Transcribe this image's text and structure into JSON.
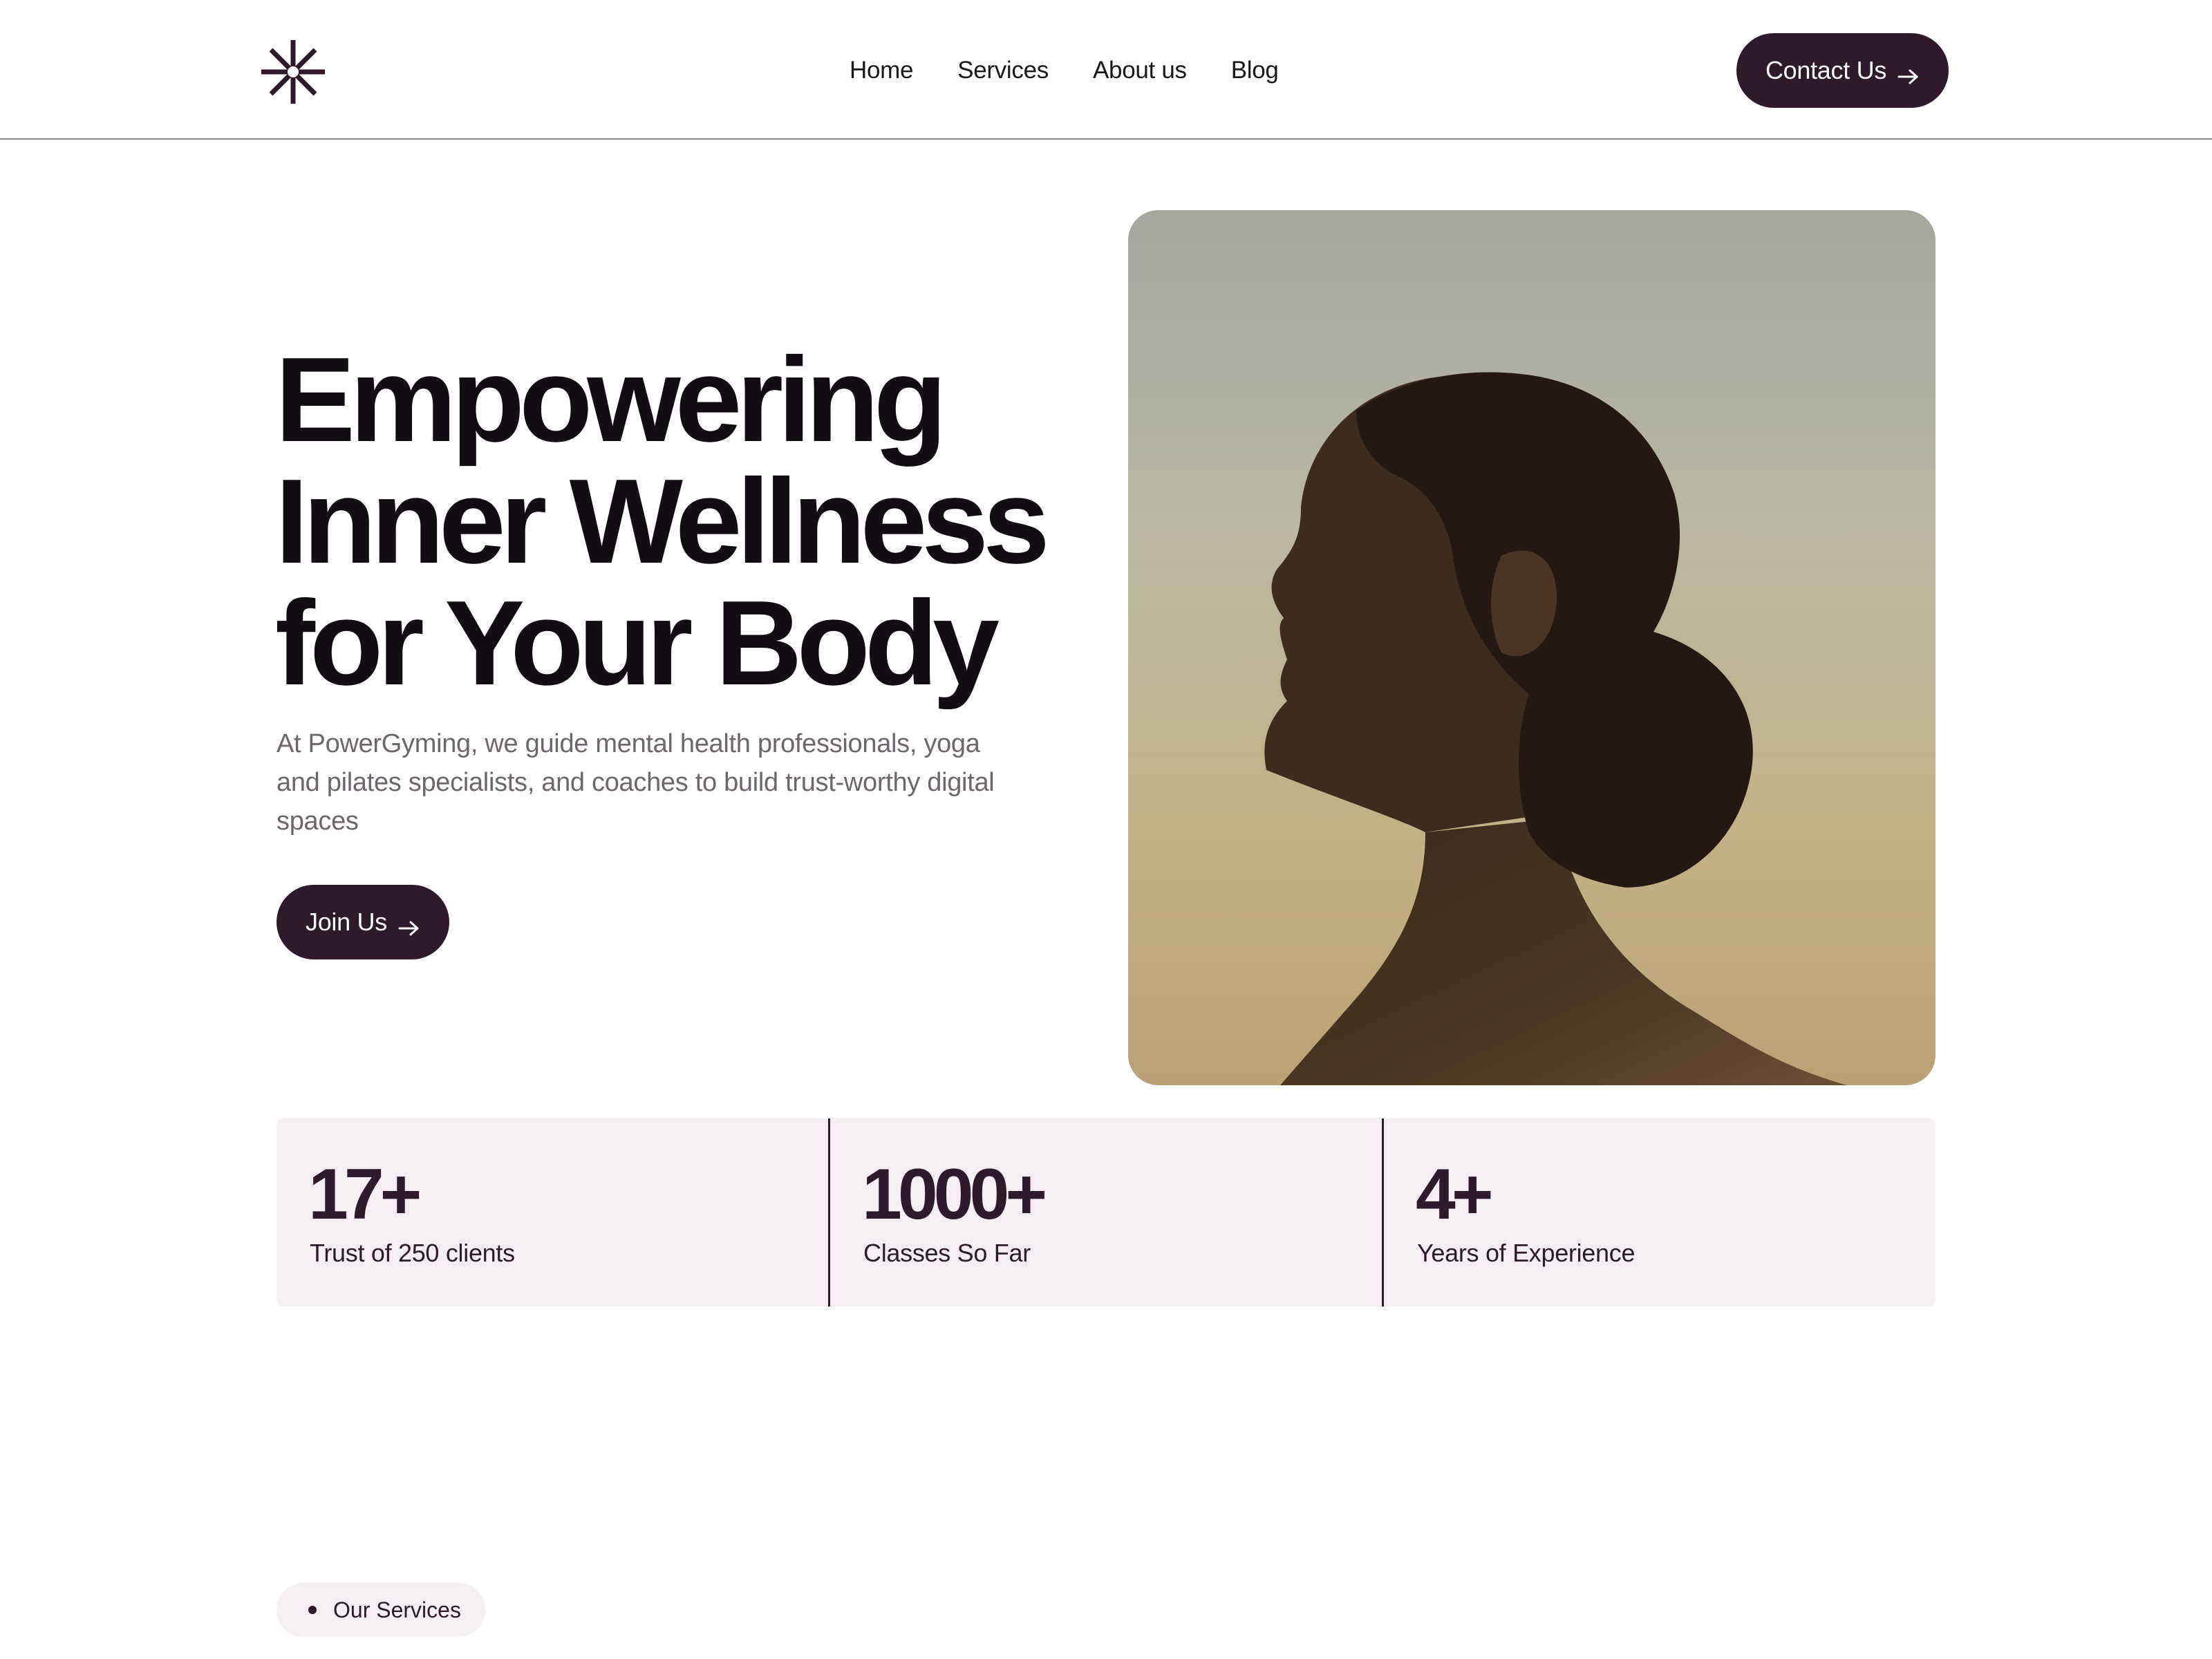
{
  "header": {
    "logo_icon": "asterisk-logo-icon",
    "nav": [
      {
        "label": "Home"
      },
      {
        "label": "Services"
      },
      {
        "label": "About us"
      },
      {
        "label": "Blog"
      }
    ],
    "contact_label": "Contact Us"
  },
  "hero": {
    "title_lines": [
      "Empowering",
      "Inner Wellness",
      "for Your Body"
    ],
    "description": "At PowerGyming, we guide mental health professionals, yoga and pilates specialists, and coaches to build trust-worthy digital spaces",
    "join_label": "Join Us",
    "image_icon": "woman-profile-photo"
  },
  "stats": [
    {
      "value": "17+",
      "label": "Trust of 250 clients"
    },
    {
      "value": "1000+",
      "label": "Classes So Far"
    },
    {
      "value": "4+",
      "label": "Years of Experience"
    }
  ],
  "services_pill": {
    "label": "Our Services"
  },
  "colors": {
    "accent": "#2e1a2a",
    "stats_bg": "#f5eff4",
    "text_muted": "#6d676d"
  }
}
